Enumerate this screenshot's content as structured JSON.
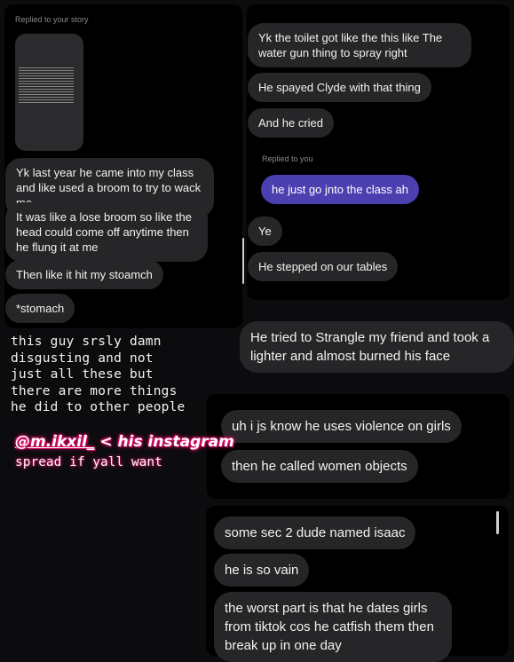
{
  "left_panel": {
    "replied_label": "Replied to your story",
    "messages": [
      "Yk last year he came into my class and like used a broom to try to wack me",
      "It was like a lose broom so like the head could come off anytime then he flung it at me",
      "Then like it hit my stoamch",
      "*stomach"
    ]
  },
  "right_panel": {
    "messages_top": [
      "Yk the toilet got like the this like The water gun thing to spray right",
      "He spayed Clyde with that thing",
      "And he cried"
    ],
    "replied_label": "Replied to you",
    "reply_message": "he just go jnto the class ah",
    "messages_bottom": [
      "Ye",
      "He stepped on our tables"
    ]
  },
  "strangle_message": "He tried to Strangle my friend and took a lighter and almost burned his face",
  "middle_panel": {
    "messages": [
      "uh i js know he uses violence on girls",
      "then he called women objects"
    ]
  },
  "bottom_panel": {
    "messages": [
      "some sec 2 dude named isaac",
      "he is so vain",
      "the worst part is that he dates girls from tiktok cos he catfish them then break up in one day"
    ]
  },
  "caption": {
    "lines": [
      "this guy srsly damn",
      "disgusting and not",
      "just all these but",
      "there are more things",
      "he did to other people"
    ],
    "handle": "@m.ikxil_",
    "handle_suffix": " < his instagram",
    "spread": "spread if yall want"
  },
  "colors": {
    "background": "#0c0c0e",
    "bubble": "#262628",
    "reply_bubble": "#4c3fb0",
    "handle_glow": "#e0116b"
  }
}
